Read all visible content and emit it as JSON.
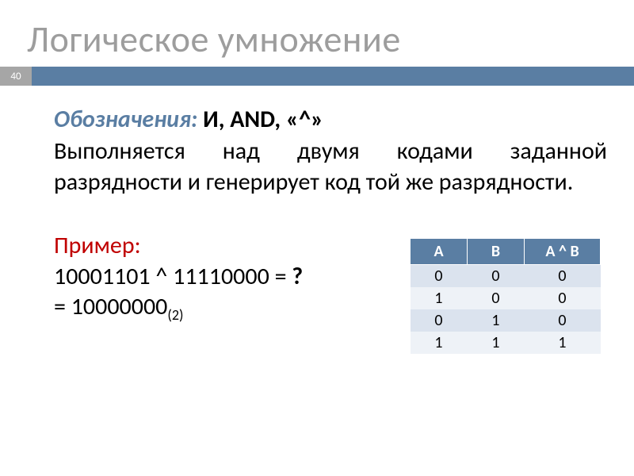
{
  "page_number": "40",
  "title": "Логическое умножение",
  "notation": {
    "label": "Обозначения:",
    "value": "И, AND, «^»"
  },
  "description": "Выполняется над двумя кодами заданной разрядности и генерирует код той же разрядности.",
  "example": {
    "label": "Пример:",
    "line1_a": "10001101 ^ 11110000 = ",
    "line1_q": "?",
    "line2_prefix": "= 10000000",
    "line2_sub": "(2)"
  },
  "truth_table": {
    "headers": [
      "A",
      "B",
      "A ^ B"
    ],
    "rows": [
      [
        "0",
        "0",
        "0"
      ],
      [
        "1",
        "0",
        "0"
      ],
      [
        "0",
        "1",
        "0"
      ],
      [
        "1",
        "1",
        "1"
      ]
    ]
  },
  "chart_data": {
    "type": "table",
    "title": "Truth table for logical AND (^)",
    "columns": [
      "A",
      "B",
      "A ^ B"
    ],
    "data": [
      {
        "A": 0,
        "B": 0,
        "A ^ B": 0
      },
      {
        "A": 1,
        "B": 0,
        "A ^ B": 0
      },
      {
        "A": 0,
        "B": 1,
        "A ^ B": 0
      },
      {
        "A": 1,
        "B": 1,
        "A ^ B": 1
      }
    ]
  }
}
